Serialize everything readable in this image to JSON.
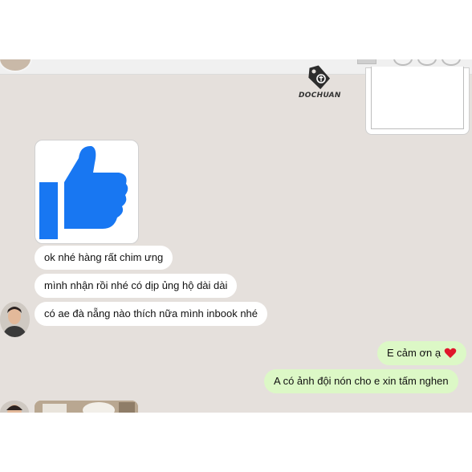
{
  "watermark": {
    "text": "DOCHUAN",
    "icon": "price-tag-icon"
  },
  "sticker": {
    "icon": "thumbs-up-icon",
    "color": "#1877f2"
  },
  "incoming": [
    "ok nhé hàng rất chim ưng",
    "mình nhận rồi nhé có dịp ủng hộ dài dài",
    "có ae đà nẵng nào thích nữa mình inbook nhé"
  ],
  "outgoing": [
    {
      "text": "E cảm ơn ạ",
      "icon": "heart-icon",
      "icon_color": "#e0162b"
    },
    {
      "text": "A có ảnh đội nón cho e xin tấm nghen"
    }
  ],
  "colors": {
    "background": "#e5e0dc",
    "incoming_bubble": "#ffffff",
    "outgoing_bubble": "#dcf8c6"
  }
}
